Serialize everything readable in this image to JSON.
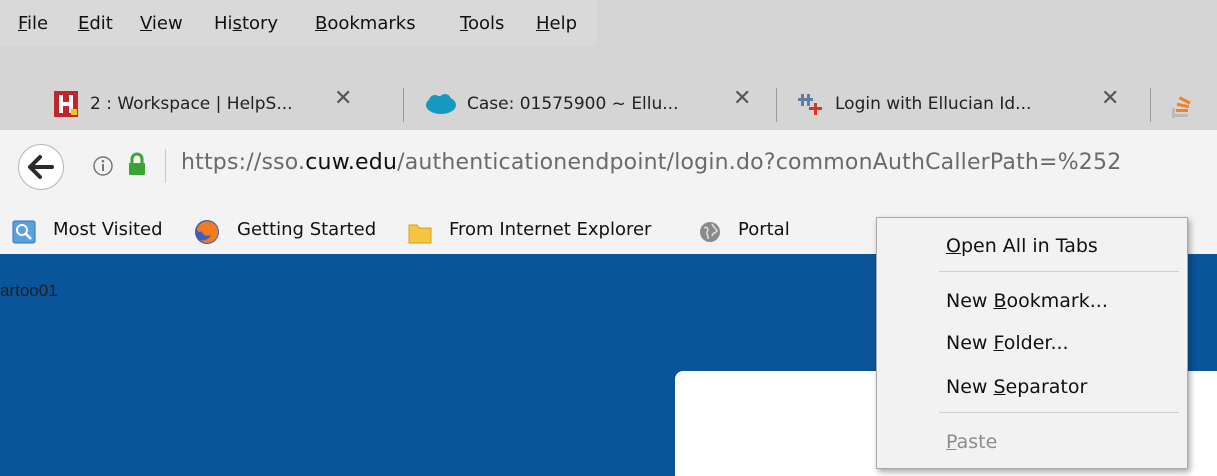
{
  "menubar": {
    "items": [
      {
        "pre": "",
        "key": "F",
        "post": "ile"
      },
      {
        "pre": "",
        "key": "E",
        "post": "dit"
      },
      {
        "pre": "",
        "key": "V",
        "post": "iew"
      },
      {
        "pre": "Hi",
        "key": "s",
        "post": "tory"
      },
      {
        "pre": "",
        "key": "B",
        "post": "ookmarks"
      },
      {
        "pre": "",
        "key": "T",
        "post": "ools"
      },
      {
        "pre": "",
        "key": "H",
        "post": "elp"
      }
    ]
  },
  "tabs": [
    {
      "title": "2 : Workspace | HelpS...",
      "icon": "helpspot-icon",
      "close": "✕"
    },
    {
      "title": "Case: 01575900 ~ Ellu...",
      "icon": "salesforce-cloud-icon",
      "close": "✕"
    },
    {
      "title": "Login with Ellucian Id...",
      "icon": "ellucian-icon",
      "close": "✕"
    }
  ],
  "urlbar": {
    "prefix": "https://sso.",
    "domain": "cuw.edu",
    "path": "/authenticationendpoint/login.do?commonAuthCallerPath=%252"
  },
  "bookmarks": [
    {
      "label": "Most Visited",
      "icon": "most-visited-icon"
    },
    {
      "label": "Getting Started",
      "icon": "firefox-icon"
    },
    {
      "label": "From Internet Explorer",
      "icon": "folder-icon"
    },
    {
      "label": "Portal",
      "icon": "globe-icon"
    }
  ],
  "page": {
    "username_fragment": "artoo01"
  },
  "context_menu": {
    "open_all": {
      "pre": "",
      "key": "O",
      "post": "pen All in Tabs"
    },
    "new_bookmark": {
      "pre": "New ",
      "key": "B",
      "post": "ookmark..."
    },
    "new_folder": {
      "pre": "New ",
      "key": "F",
      "post": "older..."
    },
    "new_separator": {
      "pre": "New ",
      "key": "S",
      "post": "eparator"
    },
    "paste": {
      "pre": "",
      "key": "P",
      "post": "aste"
    }
  },
  "colors": {
    "page_background": "#0a5499",
    "lock_green": "#3aa335",
    "helpspot_red": "#c0272d"
  }
}
